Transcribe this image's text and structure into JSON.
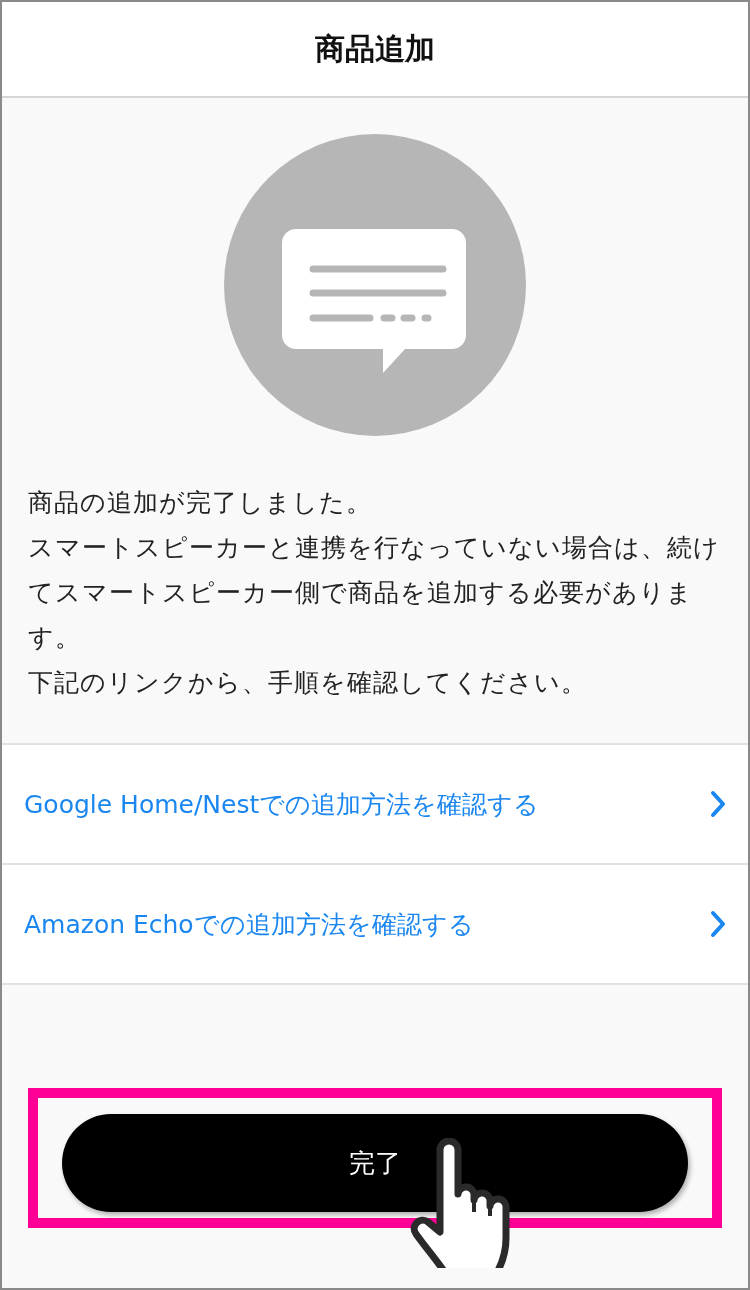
{
  "header": {
    "title": "商品追加"
  },
  "message": {
    "paragraphs": [
      "商品の追加が完了しました。",
      "スマートスピーカーと連携を行なっていない場合は、続けてスマートスピーカー側で商品を追加する必要があります。",
      "下記のリンクから、手順を確認してください。"
    ]
  },
  "links": [
    {
      "label": "Google Home/Nestでの追加方法を確認する"
    },
    {
      "label": "Amazon Echoでの追加方法を確認する"
    }
  ],
  "done_button": {
    "label": "完了",
    "highlighted": true,
    "pointer": true
  }
}
